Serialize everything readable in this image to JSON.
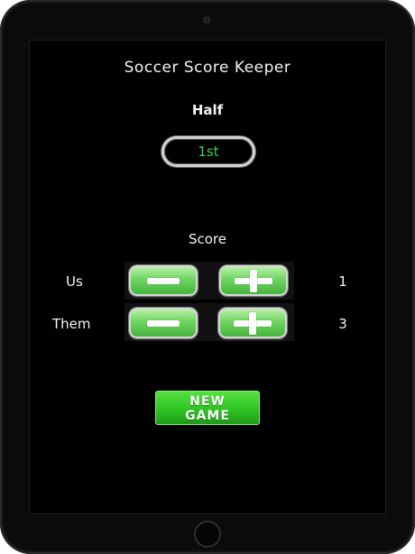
{
  "app": {
    "title": "Soccer Score Keeper"
  },
  "half": {
    "label": "Half",
    "selected": "1st"
  },
  "score": {
    "label": "Score",
    "teams": [
      {
        "name": "Us",
        "score": "1"
      },
      {
        "name": "Them",
        "score": "3"
      }
    ]
  },
  "actions": {
    "new_game_label": "NEW\nGAME"
  },
  "colors": {
    "background": "#000000",
    "accent_green": "#3bd14a",
    "button_green": "#45b43c",
    "text": "#f4f4f4"
  },
  "icons": {
    "decrement": "minus-icon",
    "increment": "plus-icon"
  }
}
